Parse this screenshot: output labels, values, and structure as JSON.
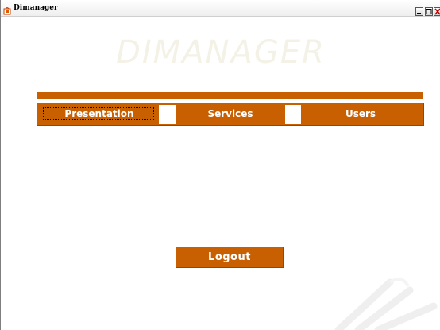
{
  "window": {
    "title": "Dimanager",
    "controls": [
      "minimize",
      "maximize",
      "close"
    ]
  },
  "brand": {
    "text": "DIMANAGER"
  },
  "nav": {
    "items": [
      {
        "label": "Presentation",
        "focused": true
      },
      {
        "label": "Services"
      },
      {
        "label": "Users"
      }
    ]
  },
  "logout": {
    "label": "Logout"
  },
  "colors": {
    "accent": "#c85f00",
    "accent_border": "#8c4a10",
    "brand_text": "#f4f2e6",
    "background": "#ffffff"
  },
  "icons": {
    "app": "app-icon",
    "minimize": "minimize-icon",
    "maximize": "maximize-icon",
    "close": "close-icon",
    "watermark": "watermark-logo"
  }
}
